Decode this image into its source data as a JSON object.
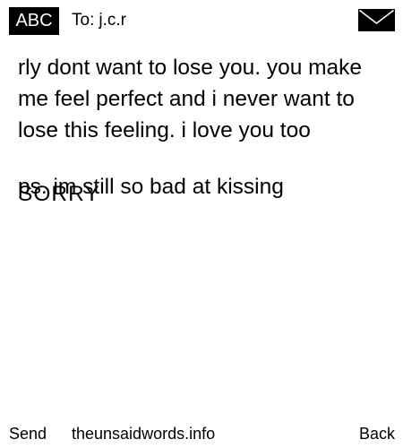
{
  "header": {
    "mode_label": "ABC",
    "recipient_label": "To:",
    "recipient_value": "j.c.r",
    "icon": "envelope-icon"
  },
  "message": {
    "body": "rly dont want to lose you. you make me feel perfect and i never want to lose this feeling. i love you too",
    "ps": "ps. im still so bad at kissing",
    "overlay": "SORRY"
  },
  "footer": {
    "left_softkey": "Send",
    "center_text": "theunsaidwords.info",
    "right_softkey": "Back"
  }
}
